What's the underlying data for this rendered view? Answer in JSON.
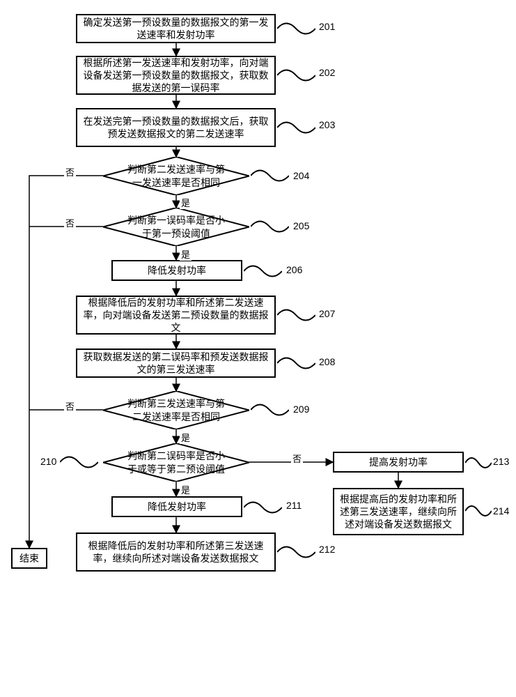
{
  "nodes": {
    "n201": "确定发送第一预设数量的数据报文的第一发送速率和发射功率",
    "n202": "根据所述第一发送速率和发射功率，向对端设备发送第一预设数量的数据报文，获取数据发送的第一误码率",
    "n203": "在发送完第一预设数量的数据报文后，获取预发送数据报文的第二发送速率",
    "n204": "判断第二发送速率与第一发送速率是否相同",
    "n205": "判断第一误码率是否小于第一预设阈值",
    "n206": "降低发射功率",
    "n207": "根据降低后的发射功率和所述第二发送速率，向对端设备发送第二预设数量的数据报文",
    "n208": "获取数据发送的第二误码率和预发送数据报文的第三发送速率",
    "n209": "判断第三发送速率与第二发送速率是否相同",
    "n210": "判断第二误码率是否小于或等于第二预设阈值",
    "n211": "降低发射功率",
    "n212": "根据降低后的发射功率和所述第三发送速率，继续向所述对端设备发送数据报文",
    "n213": "提高发射功率",
    "n214": "根据提高后的发射功率和所述第三发送速率，继续向所述对端设备发送数据报文",
    "end": "结束"
  },
  "labels": {
    "l201": "201",
    "l202": "202",
    "l203": "203",
    "l204": "204",
    "l205": "205",
    "l206": "206",
    "l207": "207",
    "l208": "208",
    "l209": "209",
    "l210": "210",
    "l211": "211",
    "l212": "212",
    "l213": "213",
    "l214": "214"
  },
  "edges": {
    "yes": "是",
    "no": "否"
  }
}
